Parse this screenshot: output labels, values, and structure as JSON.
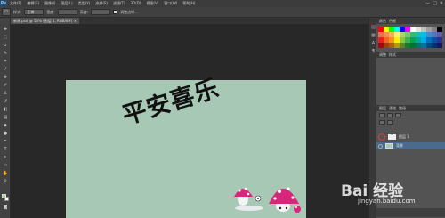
{
  "app": {
    "logo": "Ps",
    "menu": [
      "文件(F)",
      "编辑(E)",
      "图像(I)",
      "图层(L)",
      "类型(Y)",
      "选择(S)",
      "滤镜(T)",
      "3D(D)",
      "视图(V)",
      "窗口(W)",
      "帮助(H)"
    ],
    "window_controls": [
      "—",
      "□",
      "✕"
    ]
  },
  "options_bar": {
    "style_label": "样式:",
    "style_value": "正常",
    "width_label": "宽度:",
    "height_label": "高度:",
    "refine_label": "调整边缘..."
  },
  "document": {
    "tab_label": "新建.psd @ 50% (图层 1, RGB/8#) ×"
  },
  "canvas": {
    "text": "平安喜乐",
    "background_color": "#a6c8b4"
  },
  "panels": {
    "swatches_tabs": [
      "颜色",
      "色板"
    ],
    "adjust_tabs": [
      "调整",
      "样式"
    ],
    "layers_tabs": [
      "图层",
      "通道",
      "路径"
    ],
    "layers": [
      {
        "name": "图层 1",
        "thumb": "T",
        "visible": true
      },
      {
        "name": "背景",
        "thumb": "",
        "visible": true,
        "selected": true
      }
    ],
    "swatch_colors": [
      "#ff0000",
      "#ffff00",
      "#00ff00",
      "#00ffff",
      "#0000ff",
      "#ff00ff",
      "#ffffff",
      "#e0e0e0",
      "#c0c0c0",
      "#a0a0a0",
      "#808080",
      "#000000",
      "#f26c4f",
      "#f68e56",
      "#fbaf5c",
      "#fff467",
      "#acd372",
      "#7cc576",
      "#3bb878",
      "#1abbb4",
      "#00bff3",
      "#438ccb",
      "#5574b9",
      "#605ca8",
      "#ed1c24",
      "#f26522",
      "#f7941d",
      "#fff200",
      "#8dc63f",
      "#39b54a",
      "#00a651",
      "#00a99d",
      "#00aeef",
      "#0072bc",
      "#0054a6",
      "#2e3192",
      "#9e0b0f",
      "#a0410d",
      "#a36209",
      "#aba000",
      "#598527",
      "#1a7b30",
      "#007236",
      "#00746b",
      "#0076a3",
      "#004b80",
      "#003471",
      "#1b1464"
    ]
  },
  "watermark": {
    "brand": "Bai 经验",
    "url": "jingyan.baidu.com"
  }
}
